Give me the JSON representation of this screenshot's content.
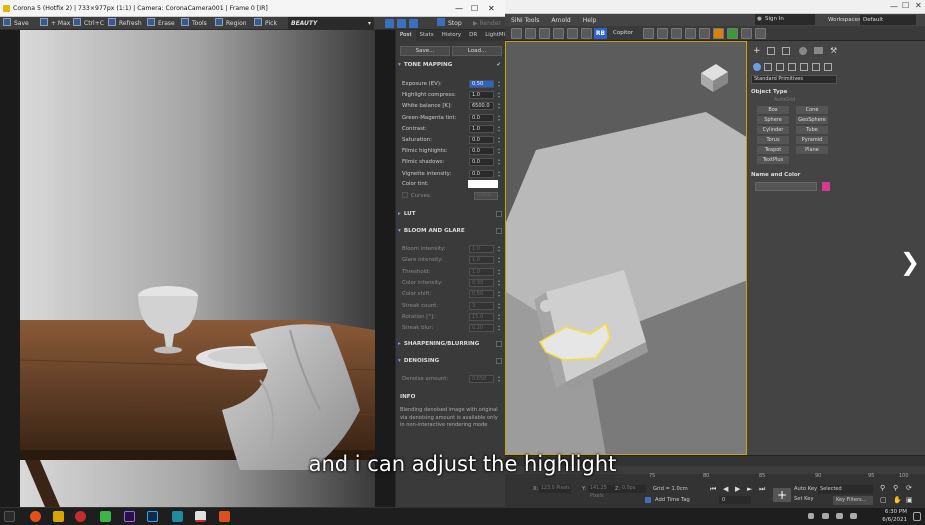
{
  "corona_window": {
    "title": "Corona 5 (Hotfix 2) | 733×977px (1:1) | Camera: CoronaCamera001 | Frame 0 [IR]",
    "toolbar": {
      "save": "Save",
      "max": "+ Max",
      "copy": "Ctrl+C",
      "refresh": "Refresh",
      "erase": "Erase",
      "tools": "Tools",
      "region": "Region",
      "pick": "Pick",
      "pass": "BEAUTY",
      "stop": "Stop",
      "render": "Render"
    },
    "panel": {
      "tabs": [
        "Post",
        "Stats",
        "History",
        "DR",
        "LightMix"
      ],
      "save_btn": "Save...",
      "load_btn": "Load...",
      "tone_mapping": {
        "header": "TONE MAPPING",
        "rows": [
          {
            "label": "Exposure (EV):",
            "value": "0.50"
          },
          {
            "label": "Highlight compress:",
            "value": "1.0"
          },
          {
            "label": "White balance [K]:",
            "value": "6500.0"
          },
          {
            "label": "Green-Magenta tint:",
            "value": "0.0"
          },
          {
            "label": "Contrast:",
            "value": "1.0"
          },
          {
            "label": "Saturation:",
            "value": "0.0"
          },
          {
            "label": "Filmic highlights:",
            "value": "0.0"
          },
          {
            "label": "Filmic shadows:",
            "value": "0.0"
          },
          {
            "label": "Vignette intensity:",
            "value": "0.0"
          }
        ],
        "color_tint": "Color tint:",
        "curves": "Curves:",
        "editor": "Editor..."
      },
      "lut_header": "LUT",
      "bloom": {
        "header": "BLOOM AND GLARE",
        "rows": [
          {
            "label": "Bloom intensity:",
            "value": "1.0"
          },
          {
            "label": "Glare intensity:",
            "value": "1.0"
          },
          {
            "label": "Threshold:",
            "value": "1.0"
          },
          {
            "label": "Color intensity:",
            "value": "0.30"
          },
          {
            "label": "Color shift:",
            "value": "0.50"
          },
          {
            "label": "Streak count:",
            "value": "3"
          },
          {
            "label": "Rotation [°]:",
            "value": "15.0"
          },
          {
            "label": "Streak blur:",
            "value": "0.20"
          }
        ]
      },
      "sharpening_header": "SHARPENING/BLURRING",
      "denoising": {
        "header": "DENOISING",
        "row": {
          "label": "Denoise amount:",
          "value": "0.650"
        }
      },
      "info": {
        "header": "INFO",
        "text": "Blending denoised image with original via denoising amount is available only in non-interactive rendering mode"
      }
    }
  },
  "max_window": {
    "menu": [
      "SiNi Tools",
      "Arnold",
      "Help"
    ],
    "sign_in": "Sign In",
    "workspaces_label": "Workspaces:",
    "workspace": "Default",
    "copitor": "Copitor",
    "rb": "RB",
    "command_panel": {
      "dropdown": "Standard Primitives",
      "object_type_header": "Object Type",
      "autogrid": "AutoGrid",
      "buttons": [
        "Box",
        "Cone",
        "Sphere",
        "GeoSphere",
        "Cylinder",
        "Tube",
        "Torus",
        "Pyramid",
        "Teapot",
        "Plane",
        "TextPlus"
      ],
      "name_color_header": "Name and Color"
    },
    "status": {
      "grid": "Grid = 1.0cm",
      "add_time_tag": "Add Time Tag",
      "auto_key": "Auto Key",
      "set_key": "Set Key",
      "selected": "Selected",
      "key_filters": "Key Filters...",
      "x_field": "123.0 Pixels",
      "y_field": "141.25 Pixels",
      "z_field": "0.0px",
      "frame": "0",
      "ticks": [
        "75",
        "80",
        "85",
        "90",
        "95",
        "100"
      ]
    }
  },
  "subtitle": "and i can adjust the highlight",
  "taskbar": {
    "time": "6:30 PM",
    "date": "6/6/2021"
  },
  "colors": {
    "viewport_border": "#c9a400",
    "color_swatch": "#d63a8a",
    "selected_highlight": "#f2e13a"
  }
}
